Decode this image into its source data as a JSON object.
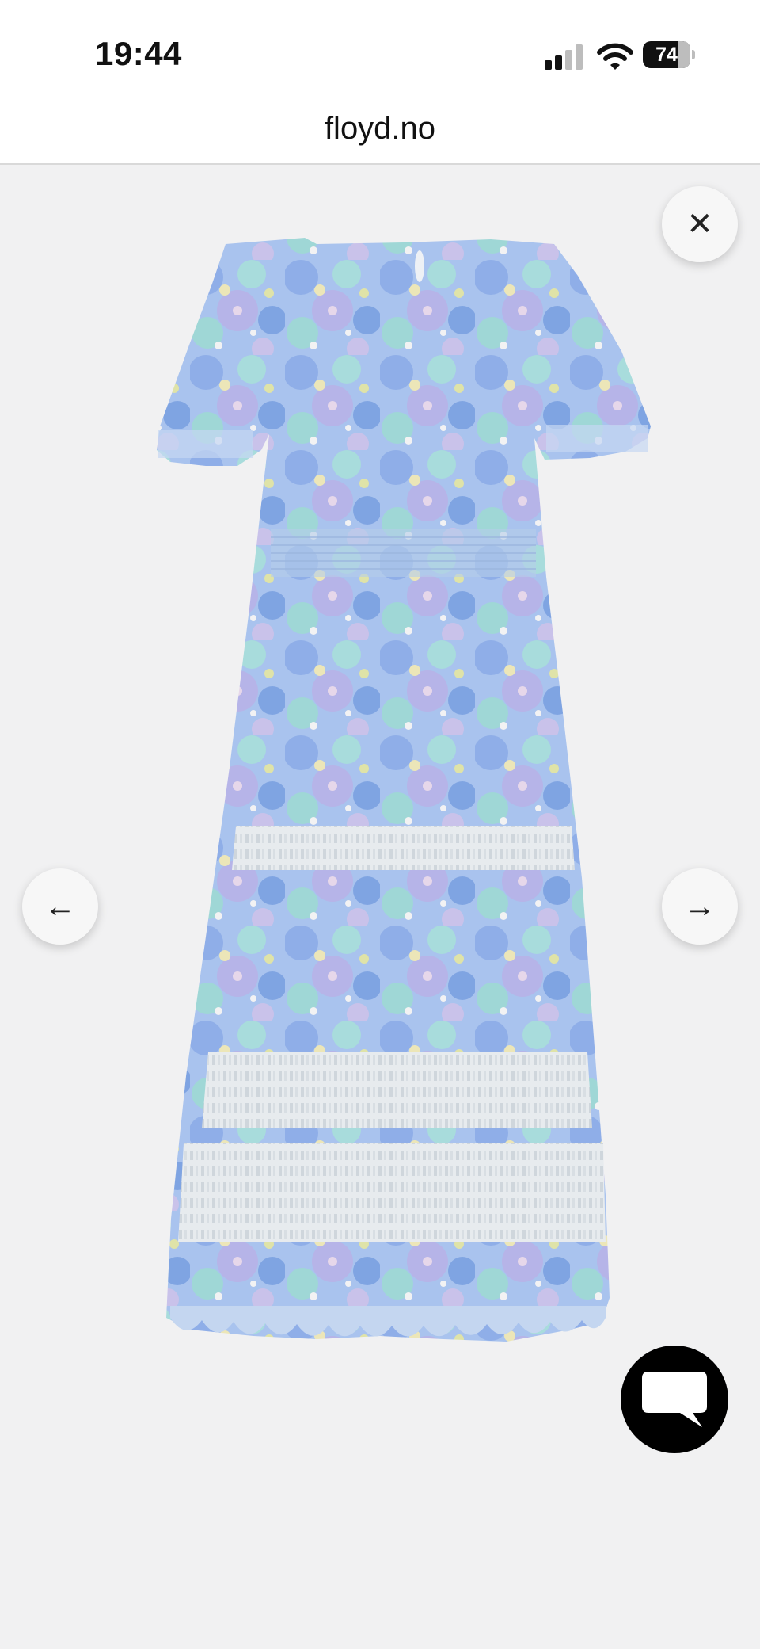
{
  "status_bar": {
    "time": "19:44",
    "battery_level": "74",
    "battery_fraction": 0.74,
    "signal_bars_active": 2,
    "signal_bars_total": 4,
    "icons": [
      "signal-icon",
      "wifi-icon",
      "battery-icon"
    ]
  },
  "browser": {
    "url": "floyd.no"
  },
  "gallery": {
    "image": "floral-blue-maxi-dress-back-view",
    "controls": [
      "close-icon",
      "arrow-left-icon",
      "arrow-right-icon"
    ],
    "close_symbol": "✕",
    "prev_symbol": "←",
    "next_symbol": "→"
  },
  "chat": {
    "icon": "chat-bubble-icon"
  },
  "colors": {
    "background": "#f1f1f2",
    "dress_blue": "#8fb2e6",
    "dress_aqua": "#9fd6d8",
    "lace_white": "#e8ecef",
    "chat_button": "#000000"
  }
}
